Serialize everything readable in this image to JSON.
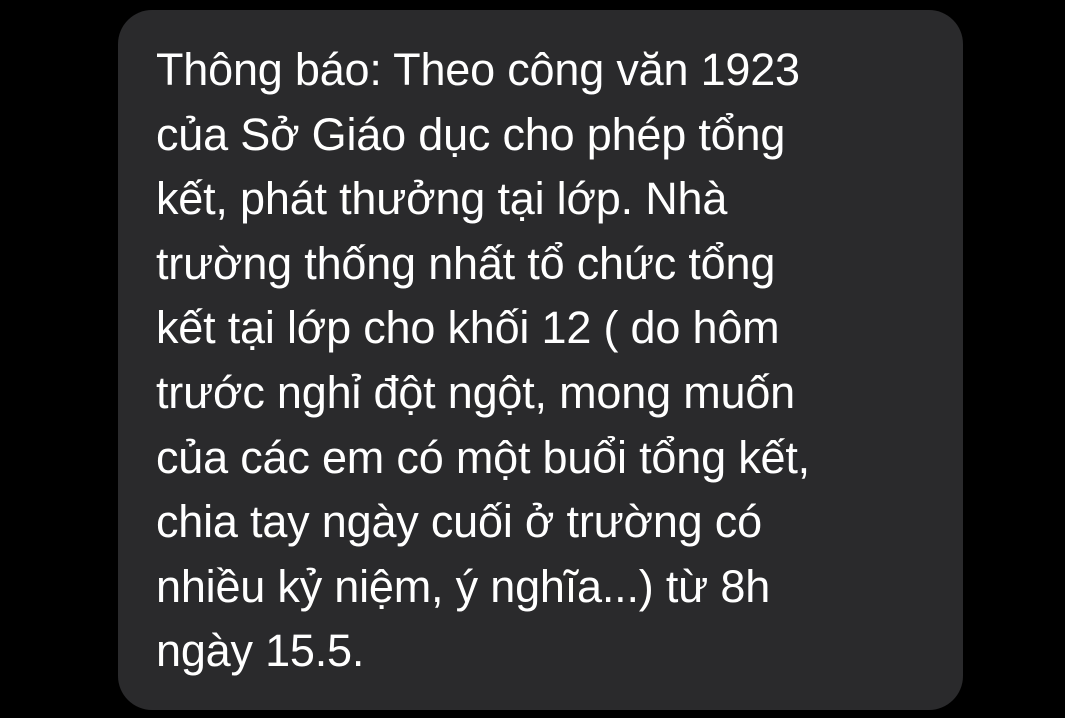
{
  "message": {
    "lines": [
      "Thông báo: Theo công văn 1923",
      "của Sở Giáo dục cho phép tổng",
      "kết, phát thưởng tại lớp. Nhà",
      "trường thống nhất tổ chức tổng",
      "kết tại lớp cho khối 12 ( do hôm",
      "trước nghỉ đột ngột, mong muốn",
      "của các em có một buổi tổng kết,",
      "chia tay ngày cuối ở trường có",
      "nhiều kỷ niệm, ý nghĩa...) từ 8h",
      "ngày 15.5."
    ]
  },
  "colors": {
    "background": "#000000",
    "bubble": "#2a2a2c",
    "text": "#ffffff"
  }
}
